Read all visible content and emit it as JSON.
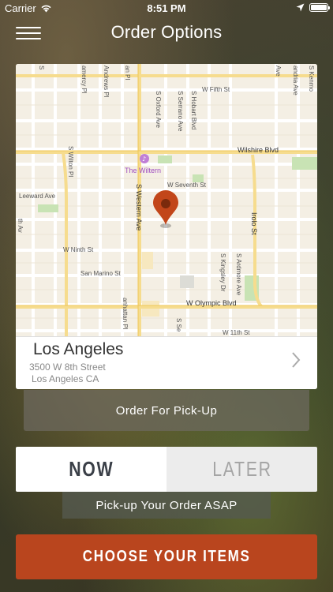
{
  "status_bar": {
    "carrier": "Carrier",
    "time": "8:51 PM"
  },
  "nav": {
    "title": "Order Options"
  },
  "map": {
    "streets": {
      "w_fifth_st": "W Fifth St",
      "wilshire_blvd": "Wilshire Blvd",
      "w_seventh_st": "W Seventh St",
      "leeward_ave": "Leeward Ave",
      "w_ninth_st": "W Ninth St",
      "san_marino_st": "San Marino St",
      "w_olympic_blvd": "W Olympic Blvd",
      "w_11th_st": "W 11th St",
      "s_wilton_pl": "S Wilton Pl",
      "s_western_ave": "S Western Ave",
      "s_oxford_ave": "S Oxford Ave",
      "s_serrano_ave": "S Serrano Ave",
      "s_hobart_blvd": "S Hobart Blvd",
      "irolo_st": "Irolo St",
      "s_kingsley_dr": "S Kingsley Dr",
      "s_ardmore_ave": "S Ardmore Ave",
      "andrews_pl": "Andrews Pl",
      "gramercy_pl": "amercy Pl",
      "manhattan_pl": "anhattan Pl",
      "alexandria_ave": "andria Ave",
      "s_kenmore": "S Kenmo",
      "s_serrano_lower": "S Se",
      "s_ave_fragment": "S",
      "ave_fragment": "Ave",
      "n_ave_fragment": "an Pl",
      "left_fragment": "th Av"
    },
    "poi": {
      "the_wiltern": "The Wiltern"
    },
    "pin_color": "#c2461a"
  },
  "location": {
    "city": "Los Angeles",
    "street": "3500 W 8th Street",
    "city_state": "Los Angeles CA"
  },
  "pickup": {
    "label": "Order For Pick-Up"
  },
  "time_toggle": {
    "now_label": "NOW",
    "later_label": "LATER",
    "selected": "NOW"
  },
  "asap": {
    "label": "Pick-up Your Order ASAP"
  },
  "cta": {
    "label": "CHOOSE YOUR ITEMS",
    "color": "#b9451e"
  }
}
